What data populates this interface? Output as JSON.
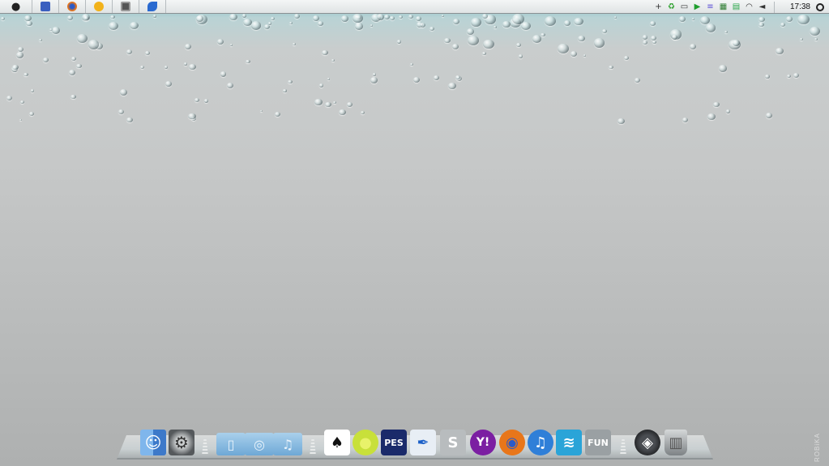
{
  "menubar": {
    "items": [
      {
        "icon": "apple-icon",
        "color": "#222222"
      },
      {
        "icon": "document-icon",
        "color": "#3a5fbf"
      },
      {
        "icon": "firefox-icon",
        "color": "#e8761a"
      },
      {
        "icon": "smiley-icon",
        "color": "#f2b21a"
      },
      {
        "icon": "monitor-icon",
        "color": "#555555"
      },
      {
        "icon": "feather-icon",
        "color": "#2a6ad0"
      }
    ],
    "tray": {
      "icons": [
        {
          "name": "plus-icon",
          "glyph": "+",
          "color": "#333333"
        },
        {
          "name": "recycle-icon",
          "glyph": "♻",
          "color": "#2ca02c"
        },
        {
          "name": "battery-icon",
          "glyph": "▭",
          "color": "#333333"
        },
        {
          "name": "play-icon",
          "glyph": "▶",
          "color": "#1f9e2e"
        },
        {
          "name": "notes-icon",
          "glyph": "≡",
          "color": "#5b4fd6"
        },
        {
          "name": "network-icon",
          "glyph": "▦",
          "color": "#2e7d32"
        },
        {
          "name": "chat-icon",
          "glyph": "▤",
          "color": "#2aa84a"
        },
        {
          "name": "wifi-icon",
          "glyph": "◠",
          "color": "#333333"
        },
        {
          "name": "volume-icon",
          "glyph": "◄",
          "color": "#333333"
        }
      ],
      "clock": "17:38",
      "search_icon": "search-icon"
    }
  },
  "dock": {
    "left_apps": [
      {
        "name": "finder",
        "color": "#4a8fd8"
      },
      {
        "name": "system-preferences",
        "color": "#6d7073"
      }
    ],
    "folders": [
      {
        "name": "documents-folder",
        "glyph": "▯"
      },
      {
        "name": "pictures-folder",
        "glyph": "◎"
      },
      {
        "name": "music-folder",
        "glyph": "♫"
      }
    ],
    "apps": [
      {
        "name": "solitaire",
        "glyph": "♠",
        "color": "#ffffff",
        "fg": "#111111"
      },
      {
        "name": "tennis",
        "glyph": "●",
        "color": "#c8e03a",
        "fg": "#e8f26a"
      },
      {
        "name": "pes-game",
        "label": "PES",
        "color": "#1a2a6a",
        "fg": "#ffffff"
      },
      {
        "name": "feather-app",
        "glyph": "✒",
        "color": "#e8eef5",
        "fg": "#1a5fc8"
      },
      {
        "name": "steam",
        "glyph": "S",
        "color": "#b8bcbe",
        "fg": "#ffffff"
      },
      {
        "name": "yahoo-messenger",
        "label": "Y!",
        "color": "#7b1fa2",
        "fg": "#ffffff"
      },
      {
        "name": "firefox",
        "glyph": "◉",
        "color": "#e8761a",
        "fg": "#2a5ac8"
      },
      {
        "name": "itunes",
        "glyph": "♫",
        "color": "#2f7fd8",
        "fg": "#ffffff"
      },
      {
        "name": "wind-app",
        "glyph": "≋",
        "color": "#2aa4d8",
        "fg": "#ffffff"
      },
      {
        "name": "fun-drive",
        "label": "FUN",
        "color": "#9aa0a3",
        "fg": "#ffffff"
      }
    ],
    "right_apps": [
      {
        "name": "dashboard",
        "glyph": "◈",
        "color": "#2b2d30",
        "fg": "#ffffff"
      },
      {
        "name": "trash",
        "glyph": "▥",
        "color": "#7d8285",
        "fg": "#e0e2e3"
      }
    ]
  },
  "watermark": "ROBiKA"
}
